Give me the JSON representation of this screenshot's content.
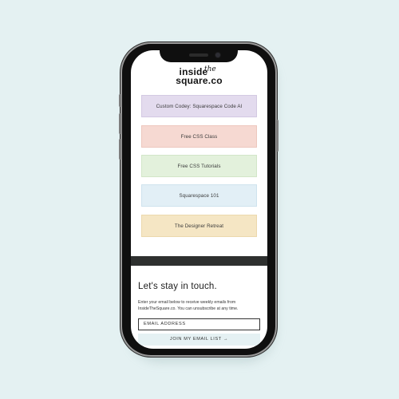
{
  "logo": {
    "line1": "inside",
    "script": "the",
    "line2": "square.co"
  },
  "links": [
    {
      "label": "Custom Codey: Squarespace Code AI",
      "color": "#e3dbee",
      "border": "#d3c9e2"
    },
    {
      "label": "Free CSS Class",
      "color": "#f6d9d2",
      "border": "#edc7bd"
    },
    {
      "label": "Free CSS Tutorials",
      "color": "#e3f1dc",
      "border": "#d2e6c8"
    },
    {
      "label": "Squarespace 101",
      "color": "#e2eff6",
      "border": "#cfe3ee"
    },
    {
      "label": "The Designer Retreat",
      "color": "#f5e6c4",
      "border": "#ecd8ac"
    }
  ],
  "newsletter": {
    "title": "Let's stay in touch.",
    "description": "Enter your email below to receive weekly emails from InsideTheSquare.co. You can unsubscribe at any time.",
    "email_placeholder": "EMAIL ADDRESS",
    "button_label": "JOIN MY EMAIL LIST →"
  },
  "colors": {
    "background": "#e4f1f2",
    "divider_band": "#2e302f",
    "join_button": "#e5f1f3"
  }
}
